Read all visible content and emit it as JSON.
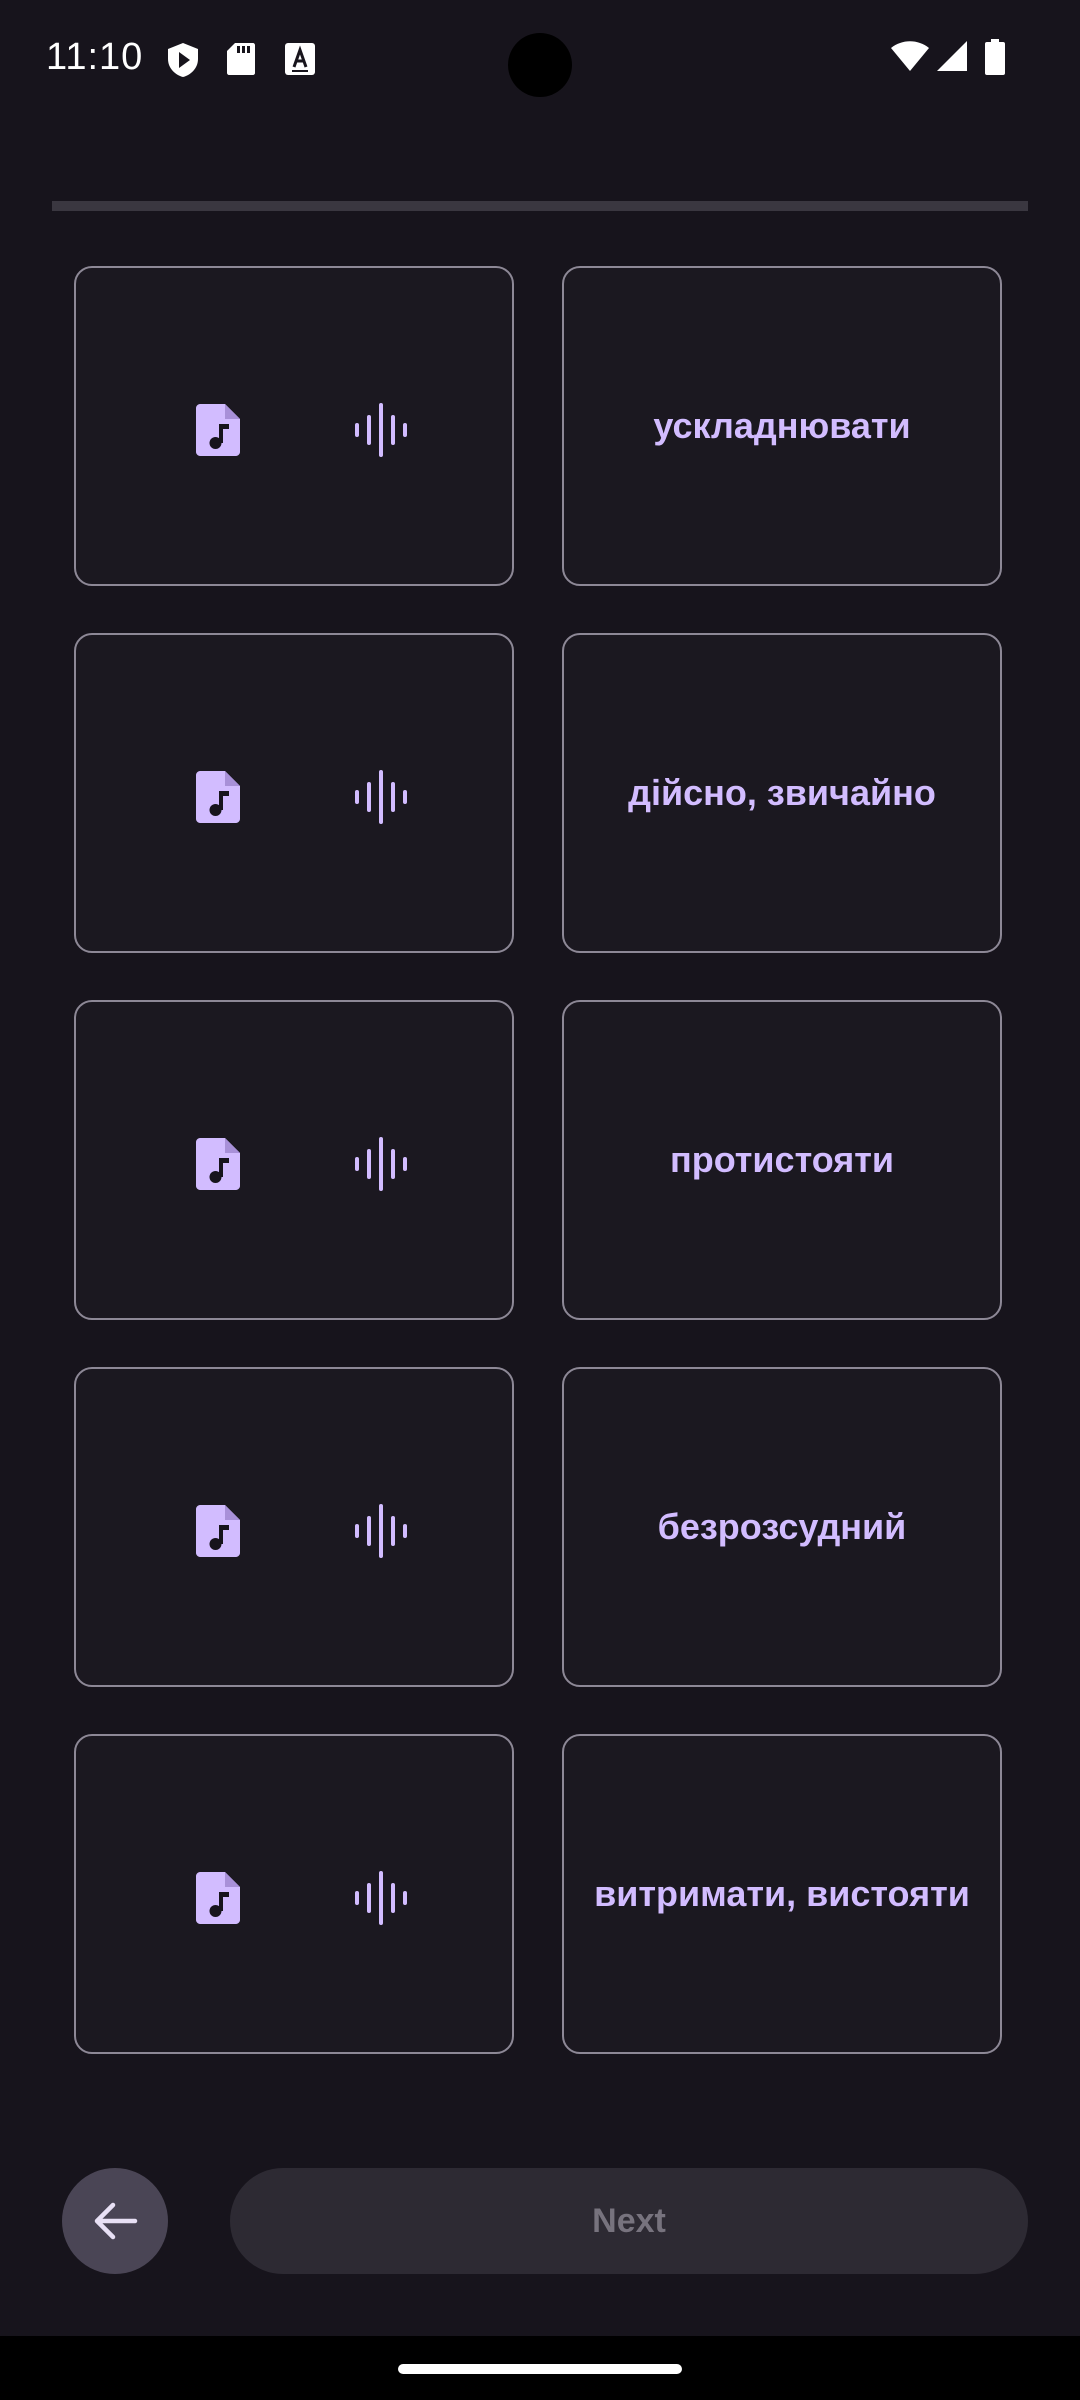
{
  "status_bar": {
    "time": "11:10",
    "icons": [
      "play-protect-icon",
      "sd-card-icon",
      "keyboard-a-icon",
      "wifi-icon",
      "signal-icon",
      "battery-icon"
    ]
  },
  "progress": {
    "fraction": 0
  },
  "pairs": [
    {
      "audio": {
        "icons": [
          "music-file-icon",
          "audio-wave-icon"
        ]
      },
      "word": "ускладнювати"
    },
    {
      "audio": {
        "icons": [
          "music-file-icon",
          "audio-wave-icon"
        ]
      },
      "word": "дійсно, звичайно"
    },
    {
      "audio": {
        "icons": [
          "music-file-icon",
          "audio-wave-icon"
        ]
      },
      "word": "протистояти"
    },
    {
      "audio": {
        "icons": [
          "music-file-icon",
          "audio-wave-icon"
        ]
      },
      "word": "безрозсудний"
    },
    {
      "audio": {
        "icons": [
          "music-file-icon",
          "audio-wave-icon"
        ]
      },
      "word": "витримати, вистояти"
    }
  ],
  "footer": {
    "back_icon": "arrow-left-icon",
    "next_label": "Next"
  },
  "colors": {
    "background": "#17141c",
    "accent": "#d2bcff",
    "tile_border": "#8d8896",
    "next_disabled_bg": "#2d2a33",
    "next_disabled_text": "#77737e"
  }
}
